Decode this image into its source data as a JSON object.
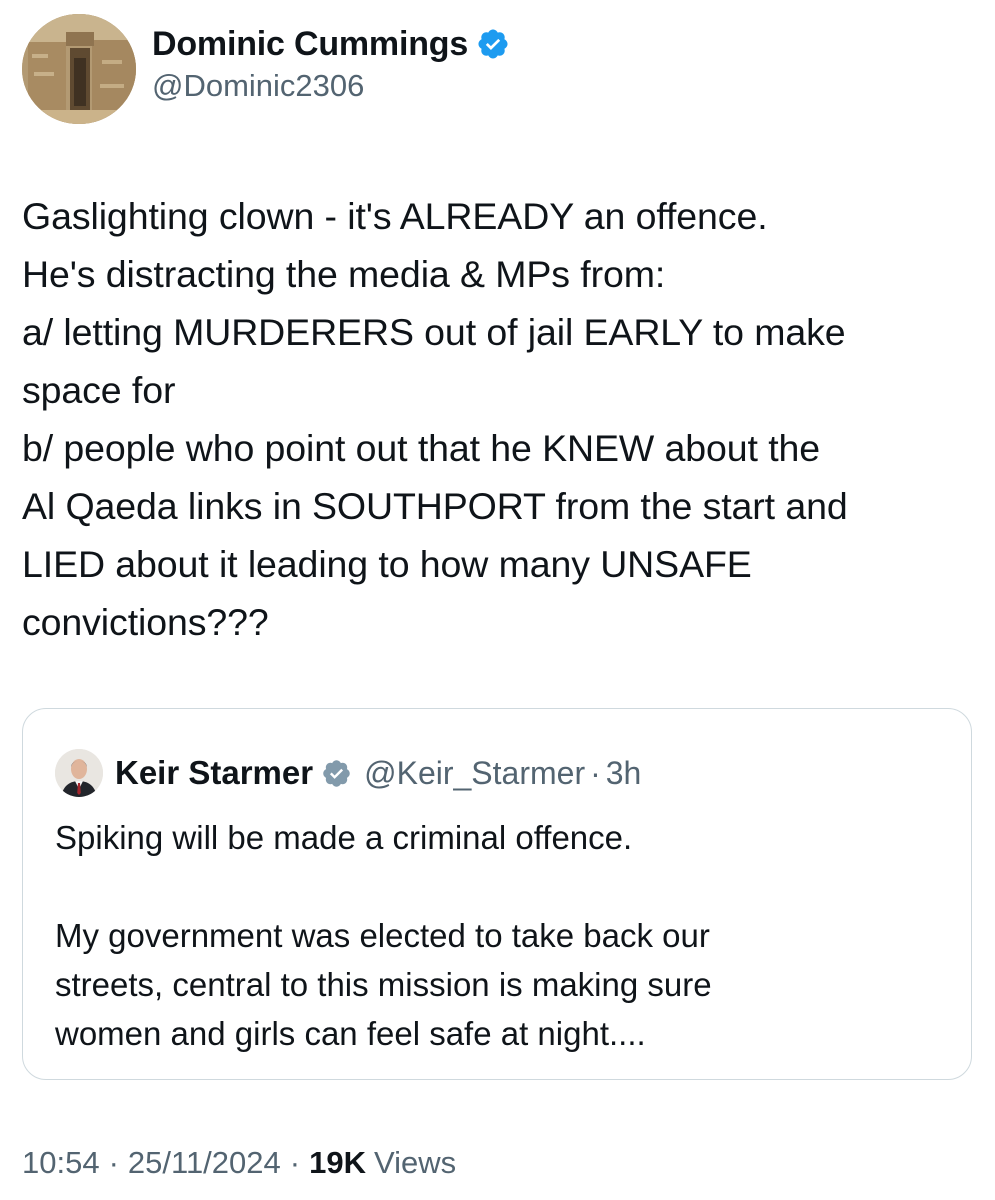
{
  "author": {
    "display_name": "Dominic Cummings",
    "handle": "@Dominic2306",
    "verified": true,
    "avatar_icon": "stone-doorway-photo"
  },
  "tweet": {
    "lines": [
      "Gaslighting clown - it's ALREADY an offence.",
      "He's distracting the media & MPs from:",
      "a/ letting MURDERERS out of jail EARLY to make",
      "space for",
      "b/ people who point out that he KNEW about the",
      "Al Qaeda links in SOUTHPORT from the start and",
      "LIED about it leading to how many UNSAFE",
      "convictions???"
    ]
  },
  "quoted_tweet": {
    "display_name": "Keir Starmer",
    "handle": "@Keir_Starmer",
    "separator": "·",
    "time": "3h",
    "verified": true,
    "avatar_icon": "portrait-photo",
    "paragraph1": "Spiking will be made a criminal offence.",
    "paragraph2_lines": [
      "My government was elected to take back our",
      "streets, central to this mission is making sure",
      "women and girls can feel safe at night...."
    ]
  },
  "meta": {
    "time": "10:54",
    "separator": "·",
    "date": "25/11/2024",
    "views_count": "19K",
    "views_label": "Views"
  },
  "colors": {
    "verified_badge": "#1d9bf0",
    "secondary_text": "#536471",
    "primary_text": "#0f1419",
    "border": "#cfd9de"
  }
}
